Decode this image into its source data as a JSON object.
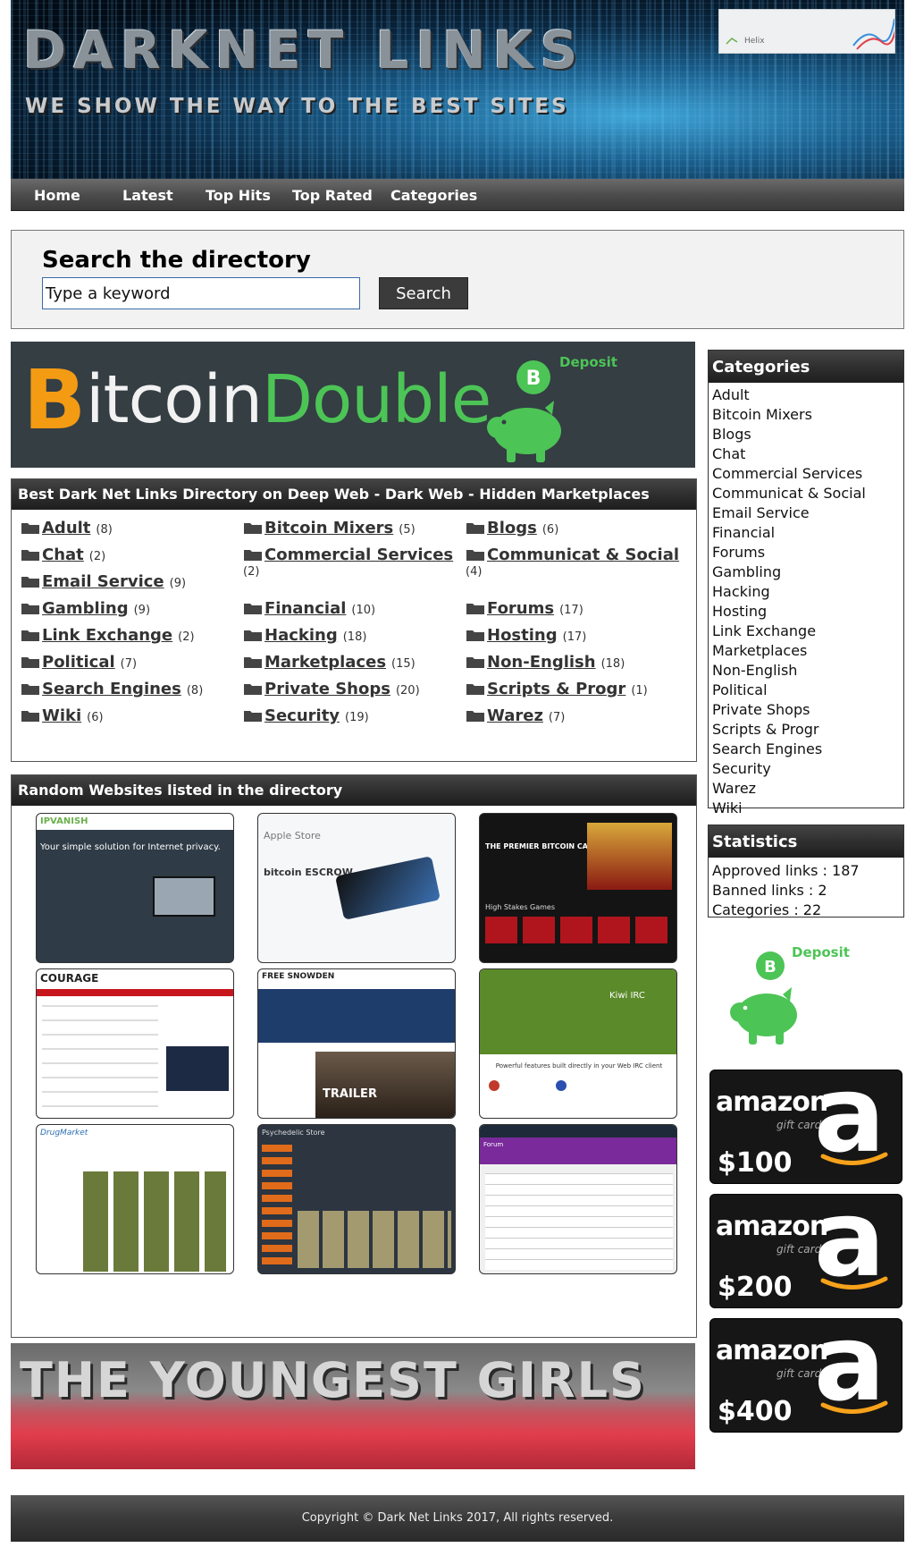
{
  "header": {
    "title": "DARKNET LINKS",
    "tagline": "WE SHOW THE WAY TO THE BEST SITES",
    "ad_text": "Helix"
  },
  "nav": {
    "items": [
      "Home",
      "Latest",
      "Top Hits",
      "Top Rated",
      "Categories"
    ]
  },
  "search": {
    "title": "Search the directory",
    "placeholder": "Type a keyword",
    "button_label": "Search"
  },
  "banner_top": {
    "b_symbol": "B",
    "word1": "itcoin",
    "word2": "Double",
    "deposit_label": "Deposit",
    "coin_symbol": "B"
  },
  "directory": {
    "title": "Best Dark Net Links Directory on Deep Web - Dark Web - Hidden Marketplaces",
    "columns": [
      [
        {
          "name": "Adult",
          "count": "(8)"
        },
        {
          "name": "Chat",
          "count": "(2)"
        },
        {
          "name": "Email Service",
          "count": "(9)"
        },
        {
          "name": "Gambling",
          "count": "(9)"
        },
        {
          "name": "Link Exchange",
          "count": "(2)"
        },
        {
          "name": "Political",
          "count": "(7)"
        },
        {
          "name": "Search Engines",
          "count": "(8)"
        },
        {
          "name": "Wiki",
          "count": "(6)"
        }
      ],
      [
        {
          "name": "Bitcoin Mixers",
          "count": "(5)"
        },
        {
          "name": "Commercial Services",
          "count": "(2)"
        },
        {
          "name": "Financial",
          "count": "(10)"
        },
        {
          "name": "Hacking",
          "count": "(18)"
        },
        {
          "name": "Marketplaces",
          "count": "(15)"
        },
        {
          "name": "Private Shops",
          "count": "(20)"
        },
        {
          "name": "Security",
          "count": "(19)"
        }
      ],
      [
        {
          "name": "Blogs",
          "count": "(6)"
        },
        {
          "name": "Communicat & Social",
          "count": "(4)"
        },
        {
          "name": "Forums",
          "count": "(17)"
        },
        {
          "name": "Hosting",
          "count": "(17)"
        },
        {
          "name": "Non-English",
          "count": "(18)"
        },
        {
          "name": "Scripts & Progr",
          "count": "(1)"
        },
        {
          "name": "Warez",
          "count": "(7)"
        }
      ]
    ]
  },
  "random": {
    "title": "Random Websites listed in the directory",
    "thumbs": [
      {
        "label": "IPVANISH",
        "line": "Your simple solution for Internet privacy."
      },
      {
        "label": "Apple Store",
        "line": "bitcoin ESCROW"
      },
      {
        "label": "THE PREMIER BITCOIN CASINO",
        "line": "High Stakes Games"
      },
      {
        "label": "COURAGE",
        "line": ""
      },
      {
        "label": "FREE SNOWDEN",
        "line": "TRAILER"
      },
      {
        "label": "Kiwi IRC",
        "line": "Powerful features built directly in your Web IRC client"
      },
      {
        "label": "DrugMarket",
        "line": ""
      },
      {
        "label": "Psychedelic Store",
        "line": ""
      },
      {
        "label": "Forum",
        "line": ""
      }
    ]
  },
  "sidebar": {
    "categories_title": "Categories",
    "categories": [
      "Adult",
      "Bitcoin Mixers",
      "Blogs",
      "Chat",
      "Commercial Services",
      "Communicat & Social",
      "Email Service",
      "Financial",
      "Forums",
      "Gambling",
      "Hacking",
      "Hosting",
      "Link Exchange",
      "Marketplaces",
      "Non-English",
      "Political",
      "Private Shops",
      "Scripts & Progr",
      "Search Engines",
      "Security",
      "Warez",
      "Wiki"
    ],
    "stats_title": "Statistics",
    "stats": [
      "Approved links : 187",
      "Banned links : 2",
      "Categories : 22"
    ],
    "deposit_label": "Deposit",
    "amazon_cards": [
      {
        "word": "amazon",
        "gift": "gift card",
        "price": "$100"
      },
      {
        "word": "amazon",
        "gift": "gift card",
        "price": "$200"
      },
      {
        "word": "amazon",
        "gift": "gift card",
        "price": "$400"
      }
    ]
  },
  "banner_bottom": {
    "text": "THE YOUNGEST GIRLS"
  },
  "footer": {
    "text": "Copyright © Dark Net Links 2017, All rights reserved."
  },
  "colors": {
    "bitcoin_orange": "#f49b14",
    "deposit_green": "#4dc456",
    "panel_header": "#2f2f2f"
  }
}
